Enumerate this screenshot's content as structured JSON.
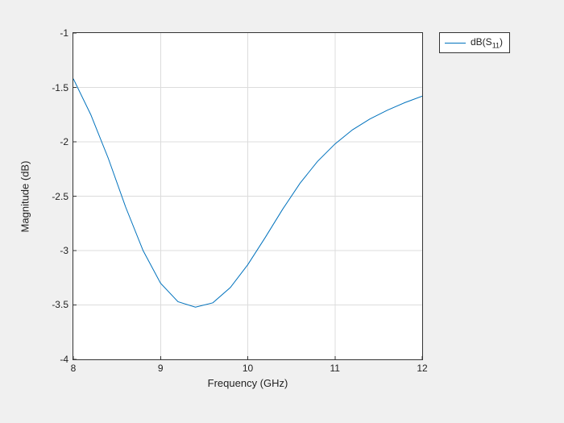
{
  "chart_data": {
    "type": "line",
    "title": "",
    "xlabel": "Frequency (GHz)",
    "ylabel": "Magnitude (dB)",
    "xlim": [
      8,
      12
    ],
    "ylim": [
      -4,
      -1
    ],
    "xticks": [
      8,
      9,
      10,
      11,
      12
    ],
    "yticks": [
      -4,
      -3.5,
      -3,
      -2.5,
      -2,
      -1.5,
      -1
    ],
    "series": [
      {
        "name": "dB(S11)",
        "x": [
          8.0,
          8.2,
          8.4,
          8.6,
          8.8,
          9.0,
          9.2,
          9.4,
          9.6,
          9.8,
          10.0,
          10.2,
          10.4,
          10.6,
          10.8,
          11.0,
          11.2,
          11.4,
          11.6,
          11.8,
          12.0
        ],
        "y": [
          -1.42,
          -1.75,
          -2.15,
          -2.6,
          -3.0,
          -3.3,
          -3.47,
          -3.52,
          -3.48,
          -3.34,
          -3.13,
          -2.88,
          -2.62,
          -2.38,
          -2.18,
          -2.02,
          -1.89,
          -1.79,
          -1.71,
          -1.64,
          -1.58
        ]
      }
    ],
    "legend": {
      "entries": [
        "dB(S₁₁)"
      ],
      "position": "outside-right-top"
    }
  },
  "axis": {
    "xlabel": "Frequency (GHz)",
    "ylabel": "Magnitude (dB)",
    "xticks": [
      "8",
      "9",
      "10",
      "11",
      "12"
    ],
    "yticks": [
      "-4",
      "-3.5",
      "-3",
      "-2.5",
      "-2",
      "-1.5",
      "-1"
    ]
  },
  "legend_label_html": "dB(S<sub>11</sub>)"
}
